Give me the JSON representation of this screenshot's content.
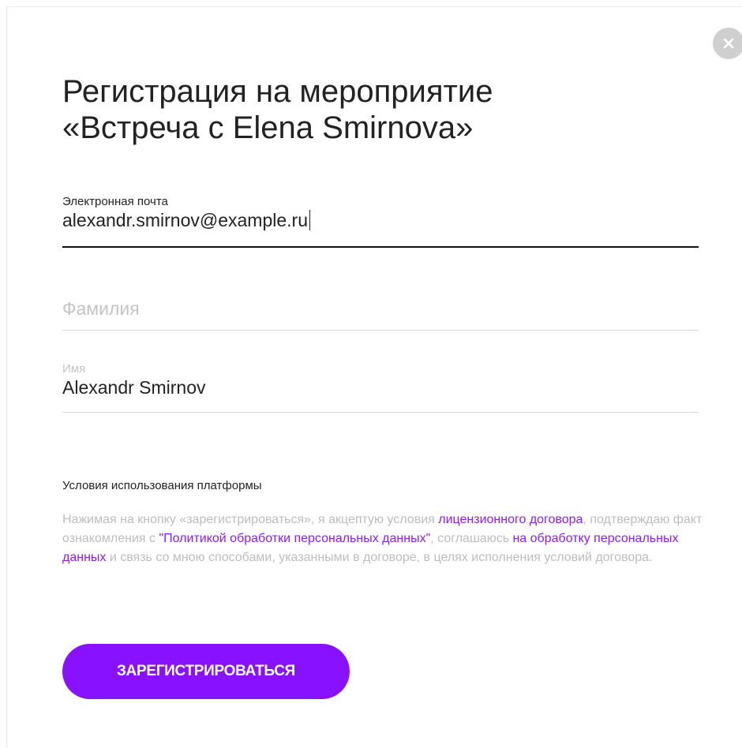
{
  "modal": {
    "title_line1": "Регистрация на мероприятие",
    "title_line2": "«Встреча с Elena Smirnova»",
    "close_icon": "close-icon"
  },
  "form": {
    "email": {
      "label": "Электронная почта",
      "value": "alexandr.smirnov@example.ru"
    },
    "surname": {
      "placeholder": "Фамилия",
      "value": ""
    },
    "name": {
      "label": "Имя",
      "value": "Alexandr Smirnov"
    }
  },
  "terms": {
    "heading": "Условия использования платформы",
    "text_1": "Нажимая на кнопку «зарегистрироваться», я акцептую условия ",
    "link_1": "лицензионного договора",
    "text_2": ", подтверждаю факт ознакомления с ",
    "link_2": "\"Политикой обработки персональных данных\"",
    "text_3": ", соглашаюсь ",
    "link_3": "на обработку персональных данных",
    "text_4": " и связь со мною способами, указанными в договоре, в целях исполнения условий договора."
  },
  "actions": {
    "register_label": "ЗАРЕГИСТРИРОВАТЬСЯ"
  },
  "colors": {
    "accent": "#8811ff",
    "link": "#8a1cff",
    "muted_text": "#bdbdbd",
    "close_bg": "#cfcfcf"
  }
}
